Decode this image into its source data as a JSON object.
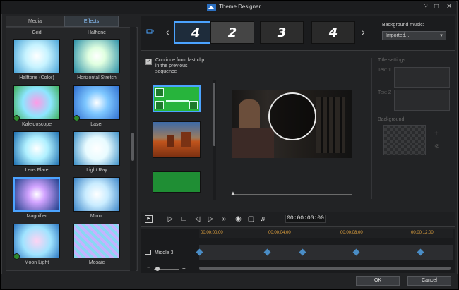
{
  "window": {
    "title": "Theme Designer",
    "help": "?",
    "minimize": "–",
    "maximize": "□",
    "close": "✕"
  },
  "tabs": [
    {
      "label": "Media"
    },
    {
      "label": "Effects"
    }
  ],
  "gallery": {
    "top_labels": [
      "Grid",
      "Halftone"
    ],
    "items": [
      {
        "label": "Halftone (Color)"
      },
      {
        "label": "Horizontal Stretch"
      },
      {
        "label": "Kaleidoscope"
      },
      {
        "label": "Laser"
      },
      {
        "label": "Lens Flare"
      },
      {
        "label": "Light Ray"
      },
      {
        "label": "Magnifier"
      },
      {
        "label": "Mirror"
      },
      {
        "label": "Moon Light"
      },
      {
        "label": "Mosaic"
      }
    ]
  },
  "strip": {
    "thumbs": [
      "4",
      "2",
      "3",
      "4"
    ]
  },
  "background_music": {
    "label": "Background music:",
    "value": "Imported..."
  },
  "continue_checkbox": {
    "label": "Continue from last clip in the previous sequence",
    "checked": true
  },
  "settings": {
    "title_settings": "Title settings",
    "text1": "Text 1",
    "text2": "Text 2",
    "background": "Background"
  },
  "playback": {
    "timecode": "00:00:00:00"
  },
  "timeline": {
    "ruler": [
      "00:00:00:00",
      "00:00:04:00",
      "00:00:08:00",
      "00:00:12:00"
    ],
    "track_label": "Middle 3"
  },
  "footer": {
    "ok": "OK",
    "cancel": "Cancel"
  },
  "colors": {
    "accent": "#4ba3ff",
    "keyframe": "#4a8dc6",
    "ruler_text": "#e3a33f",
    "playhead": "#e04b4b"
  }
}
